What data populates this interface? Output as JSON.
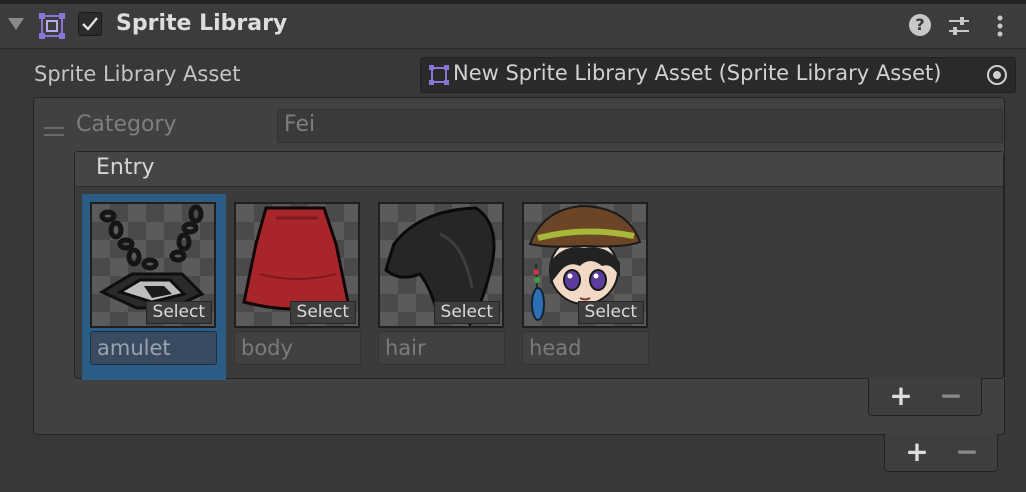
{
  "component": {
    "title": "Sprite Library",
    "enabled": true,
    "fold_icon": "foldout-expanded-icon",
    "component_icon": "sprite-library-icon",
    "help_icon_label": "?",
    "presets_icon": "presets-icon",
    "menu_icon": "kebab-menu-icon"
  },
  "asset_field": {
    "label": "Sprite Library Asset",
    "value": "New Sprite Library Asset (Sprite Library Asset)",
    "picker_icon": "object-picker-icon"
  },
  "category": {
    "label": "Category",
    "value": "Fei"
  },
  "entry": {
    "label": "Entry",
    "select_label": "Select",
    "items": [
      {
        "name": "amulet",
        "sprite": "amulet"
      },
      {
        "name": "body",
        "sprite": "body"
      },
      {
        "name": "hair",
        "sprite": "hair"
      },
      {
        "name": "head",
        "sprite": "head"
      }
    ],
    "selected_index": 0
  },
  "list_controls": {
    "add": "+",
    "remove": "−"
  },
  "colors": {
    "selection": "#2c5d87",
    "accent_icon": "#8b74d8"
  }
}
